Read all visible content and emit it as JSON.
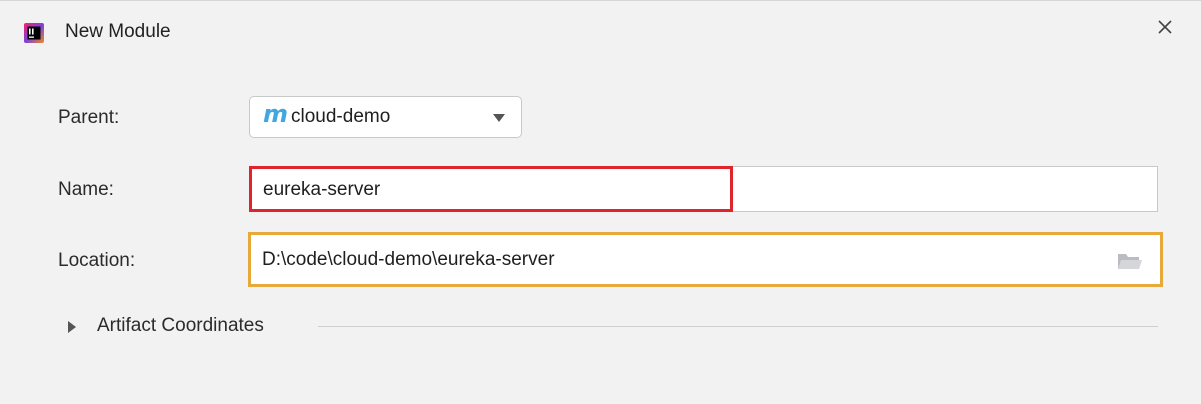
{
  "dialog": {
    "title": "New Module",
    "icons": {
      "app": "intellij-idea-icon",
      "close": "close-icon"
    }
  },
  "form": {
    "parent": {
      "label": "Parent:",
      "icon": "maven-m-icon",
      "icon_glyph": "m",
      "value": "cloud-demo"
    },
    "name": {
      "label": "Name:",
      "value": "eureka-server"
    },
    "location": {
      "label": "Location:",
      "value": "D:\\code\\cloud-demo\\eureka-server",
      "browse_icon": "folder-open-icon"
    }
  },
  "artifact": {
    "label": "Artifact Coordinates",
    "expanded": false
  },
  "colors": {
    "background": "#f2f2f2",
    "name_highlight": "#e0242e",
    "location_highlight": "#e8a93b",
    "maven_blue": "#3fa7e1"
  }
}
